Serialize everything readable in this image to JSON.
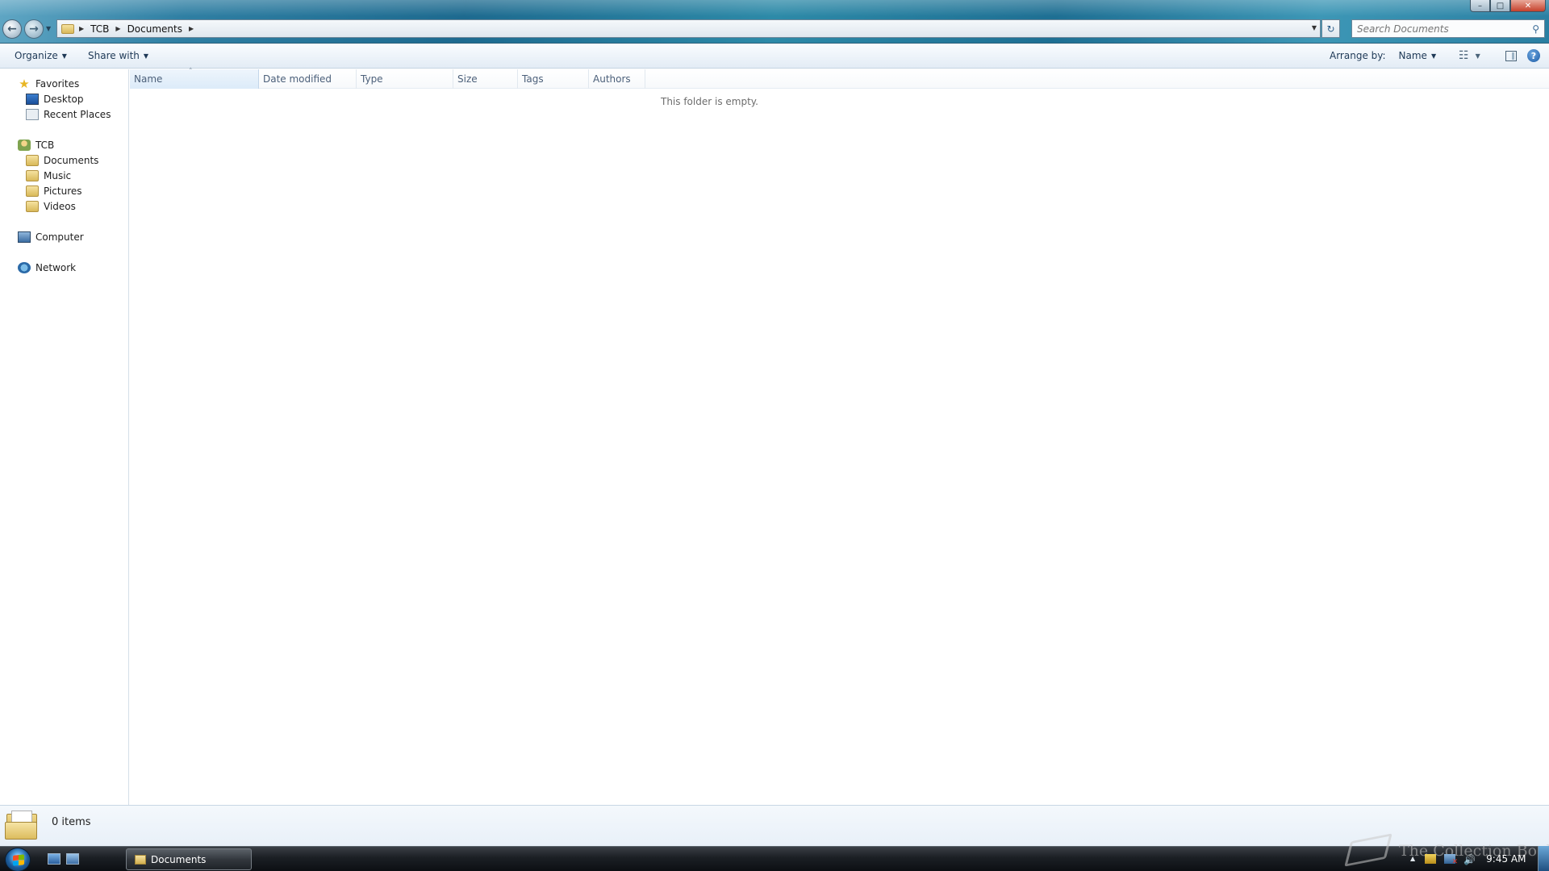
{
  "window": {
    "title": "Documents",
    "controls": {
      "minimize": "–",
      "maximize": "□",
      "close": "✕"
    }
  },
  "address": {
    "breadcrumbs": [
      "TCB",
      "Documents"
    ],
    "search_placeholder": "Search Documents"
  },
  "toolbar": {
    "organize": "Organize",
    "share_with": "Share with",
    "arrange_by_label": "Arrange by:",
    "arrange_by_value": "Name"
  },
  "navigation": {
    "favorites": {
      "label": "Favorites",
      "items": [
        "Desktop",
        "Recent Places"
      ]
    },
    "libraries": {
      "label": "TCB",
      "items": [
        "Documents",
        "Music",
        "Pictures",
        "Videos"
      ]
    },
    "computer": "Computer",
    "network": "Network"
  },
  "file_list": {
    "columns": [
      "Name",
      "Date modified",
      "Type",
      "Size",
      "Tags",
      "Authors"
    ],
    "sorted_by": "Name",
    "empty_message": "This folder is empty."
  },
  "details": {
    "item_count": "0 items"
  },
  "taskbar": {
    "active_window": "Documents",
    "clock": "9:45 AM",
    "watermark": "The Collection Book"
  },
  "icons": {
    "nav_back": "back-arrow-icon",
    "nav_forward": "forward-arrow-icon",
    "search": "magnifier-icon",
    "help": "question-mark-icon"
  },
  "colors": {
    "title_bar": "#2a7fa2",
    "command_bar": "#eef4fa",
    "accent_link": "#1e3956",
    "taskbar": "#1b1f24"
  }
}
